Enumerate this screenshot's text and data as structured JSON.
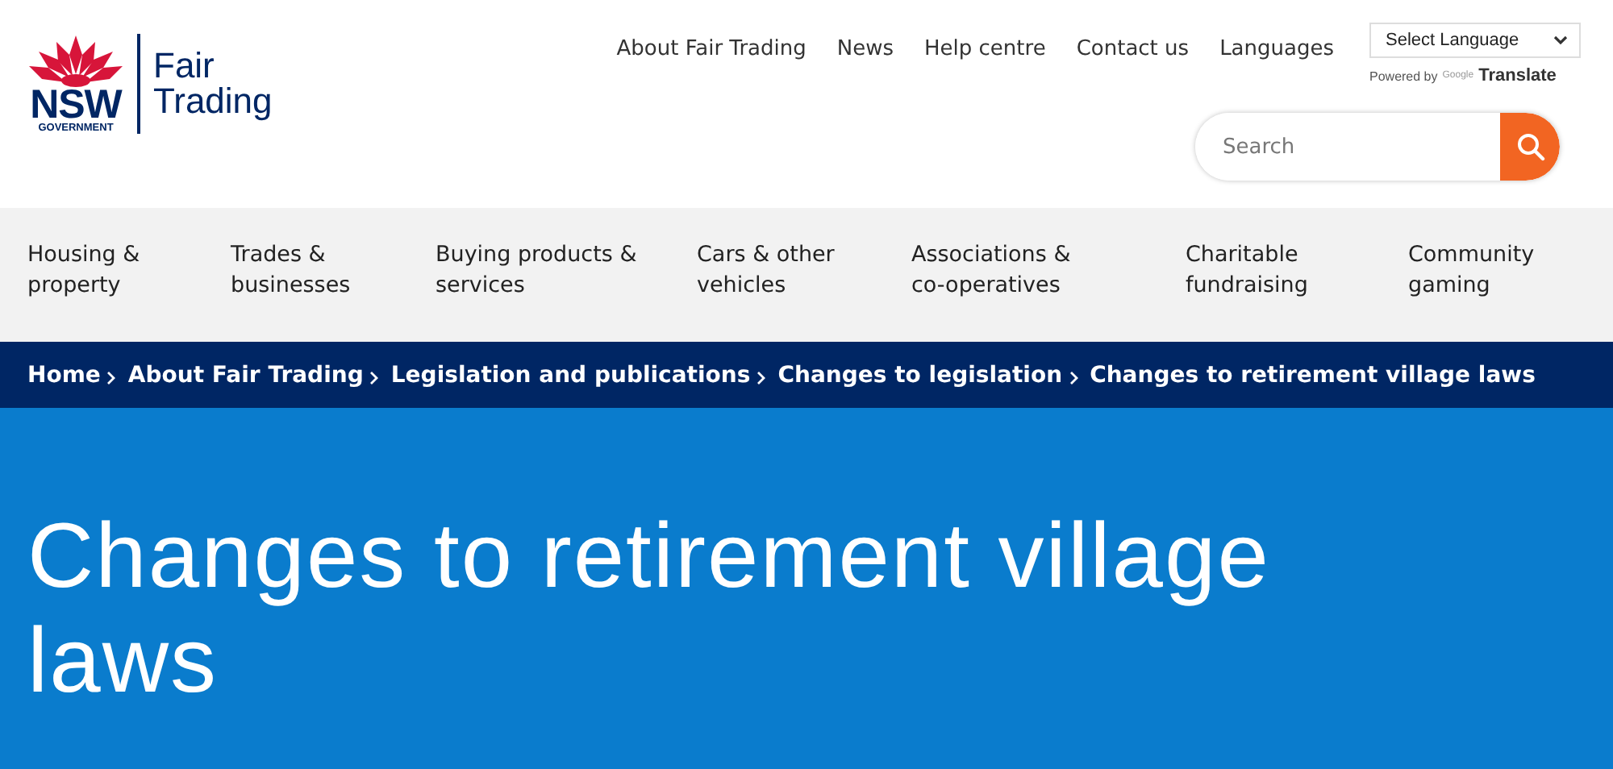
{
  "logo": {
    "brand": "NSW",
    "subbrand": "GOVERNMENT",
    "agency_line1": "Fair",
    "agency_line2": "Trading"
  },
  "top_links": [
    "About Fair Trading",
    "News",
    "Help centre",
    "Contact us",
    "Languages"
  ],
  "language_select": {
    "value": "Select Language",
    "powered_by": "Powered by",
    "google": "Google",
    "translate": "Translate"
  },
  "search": {
    "placeholder": "Search"
  },
  "main_nav": [
    {
      "line1": "Housing &",
      "line2": "property"
    },
    {
      "line1": "Trades &",
      "line2": "businesses"
    },
    {
      "line1": "Buying products &",
      "line2": "services"
    },
    {
      "line1": "Cars & other",
      "line2": "vehicles"
    },
    {
      "line1": "Associations &",
      "line2": "co-operatives"
    },
    {
      "line1": "Charitable",
      "line2": "fundraising"
    },
    {
      "line1": "Community",
      "line2": "gaming"
    }
  ],
  "breadcrumb": [
    "Home",
    "About Fair Trading",
    "Legislation and publications",
    "Changes to legislation",
    "Changes to retirement village laws"
  ],
  "hero": {
    "title": "Changes to retirement village laws"
  }
}
